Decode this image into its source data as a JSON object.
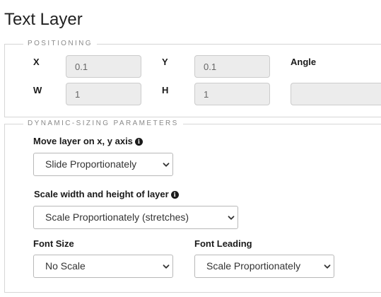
{
  "title": "Text Layer",
  "positioning": {
    "legend": "POSITIONING",
    "x_label": "X",
    "x_value": "0.1",
    "y_label": "Y",
    "y_value": "0.1",
    "angle_label": "Angle",
    "angle_value": "",
    "w_label": "W",
    "w_value": "1",
    "h_label": "H",
    "h_value": "1"
  },
  "dynamic": {
    "legend": "DYNAMIC-SIZING PARAMETERS",
    "move_label": "Move layer on x, y axis",
    "move_value": "Slide Proportionately",
    "scale_label": "Scale width and height of layer",
    "scale_value": "Scale Proportionately (stretches)",
    "font_size_label": "Font Size",
    "font_size_value": "No Scale",
    "font_leading_label": "Font Leading",
    "font_leading_value": "Scale Proportionately"
  },
  "icons": {
    "info": "info-circle-icon",
    "dropdown": "chevron-down-icon"
  }
}
